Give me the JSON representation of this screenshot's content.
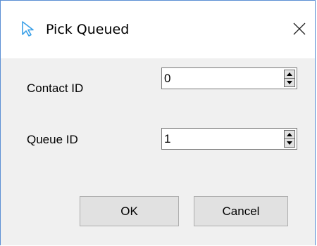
{
  "window": {
    "title": "Pick Queued",
    "close_glyph": "✕",
    "app_icon": "cursor-arrow-icon"
  },
  "form": {
    "contact_id": {
      "label": "Contact ID",
      "value": "0"
    },
    "queue_id": {
      "label": "Queue ID",
      "value": "1"
    }
  },
  "buttons": {
    "ok_label": "OK",
    "cancel_label": "Cancel"
  },
  "colors": {
    "accent": "#5b8fd4",
    "dialog_bg": "#f0f0f0",
    "button_bg": "#e1e1e1"
  }
}
